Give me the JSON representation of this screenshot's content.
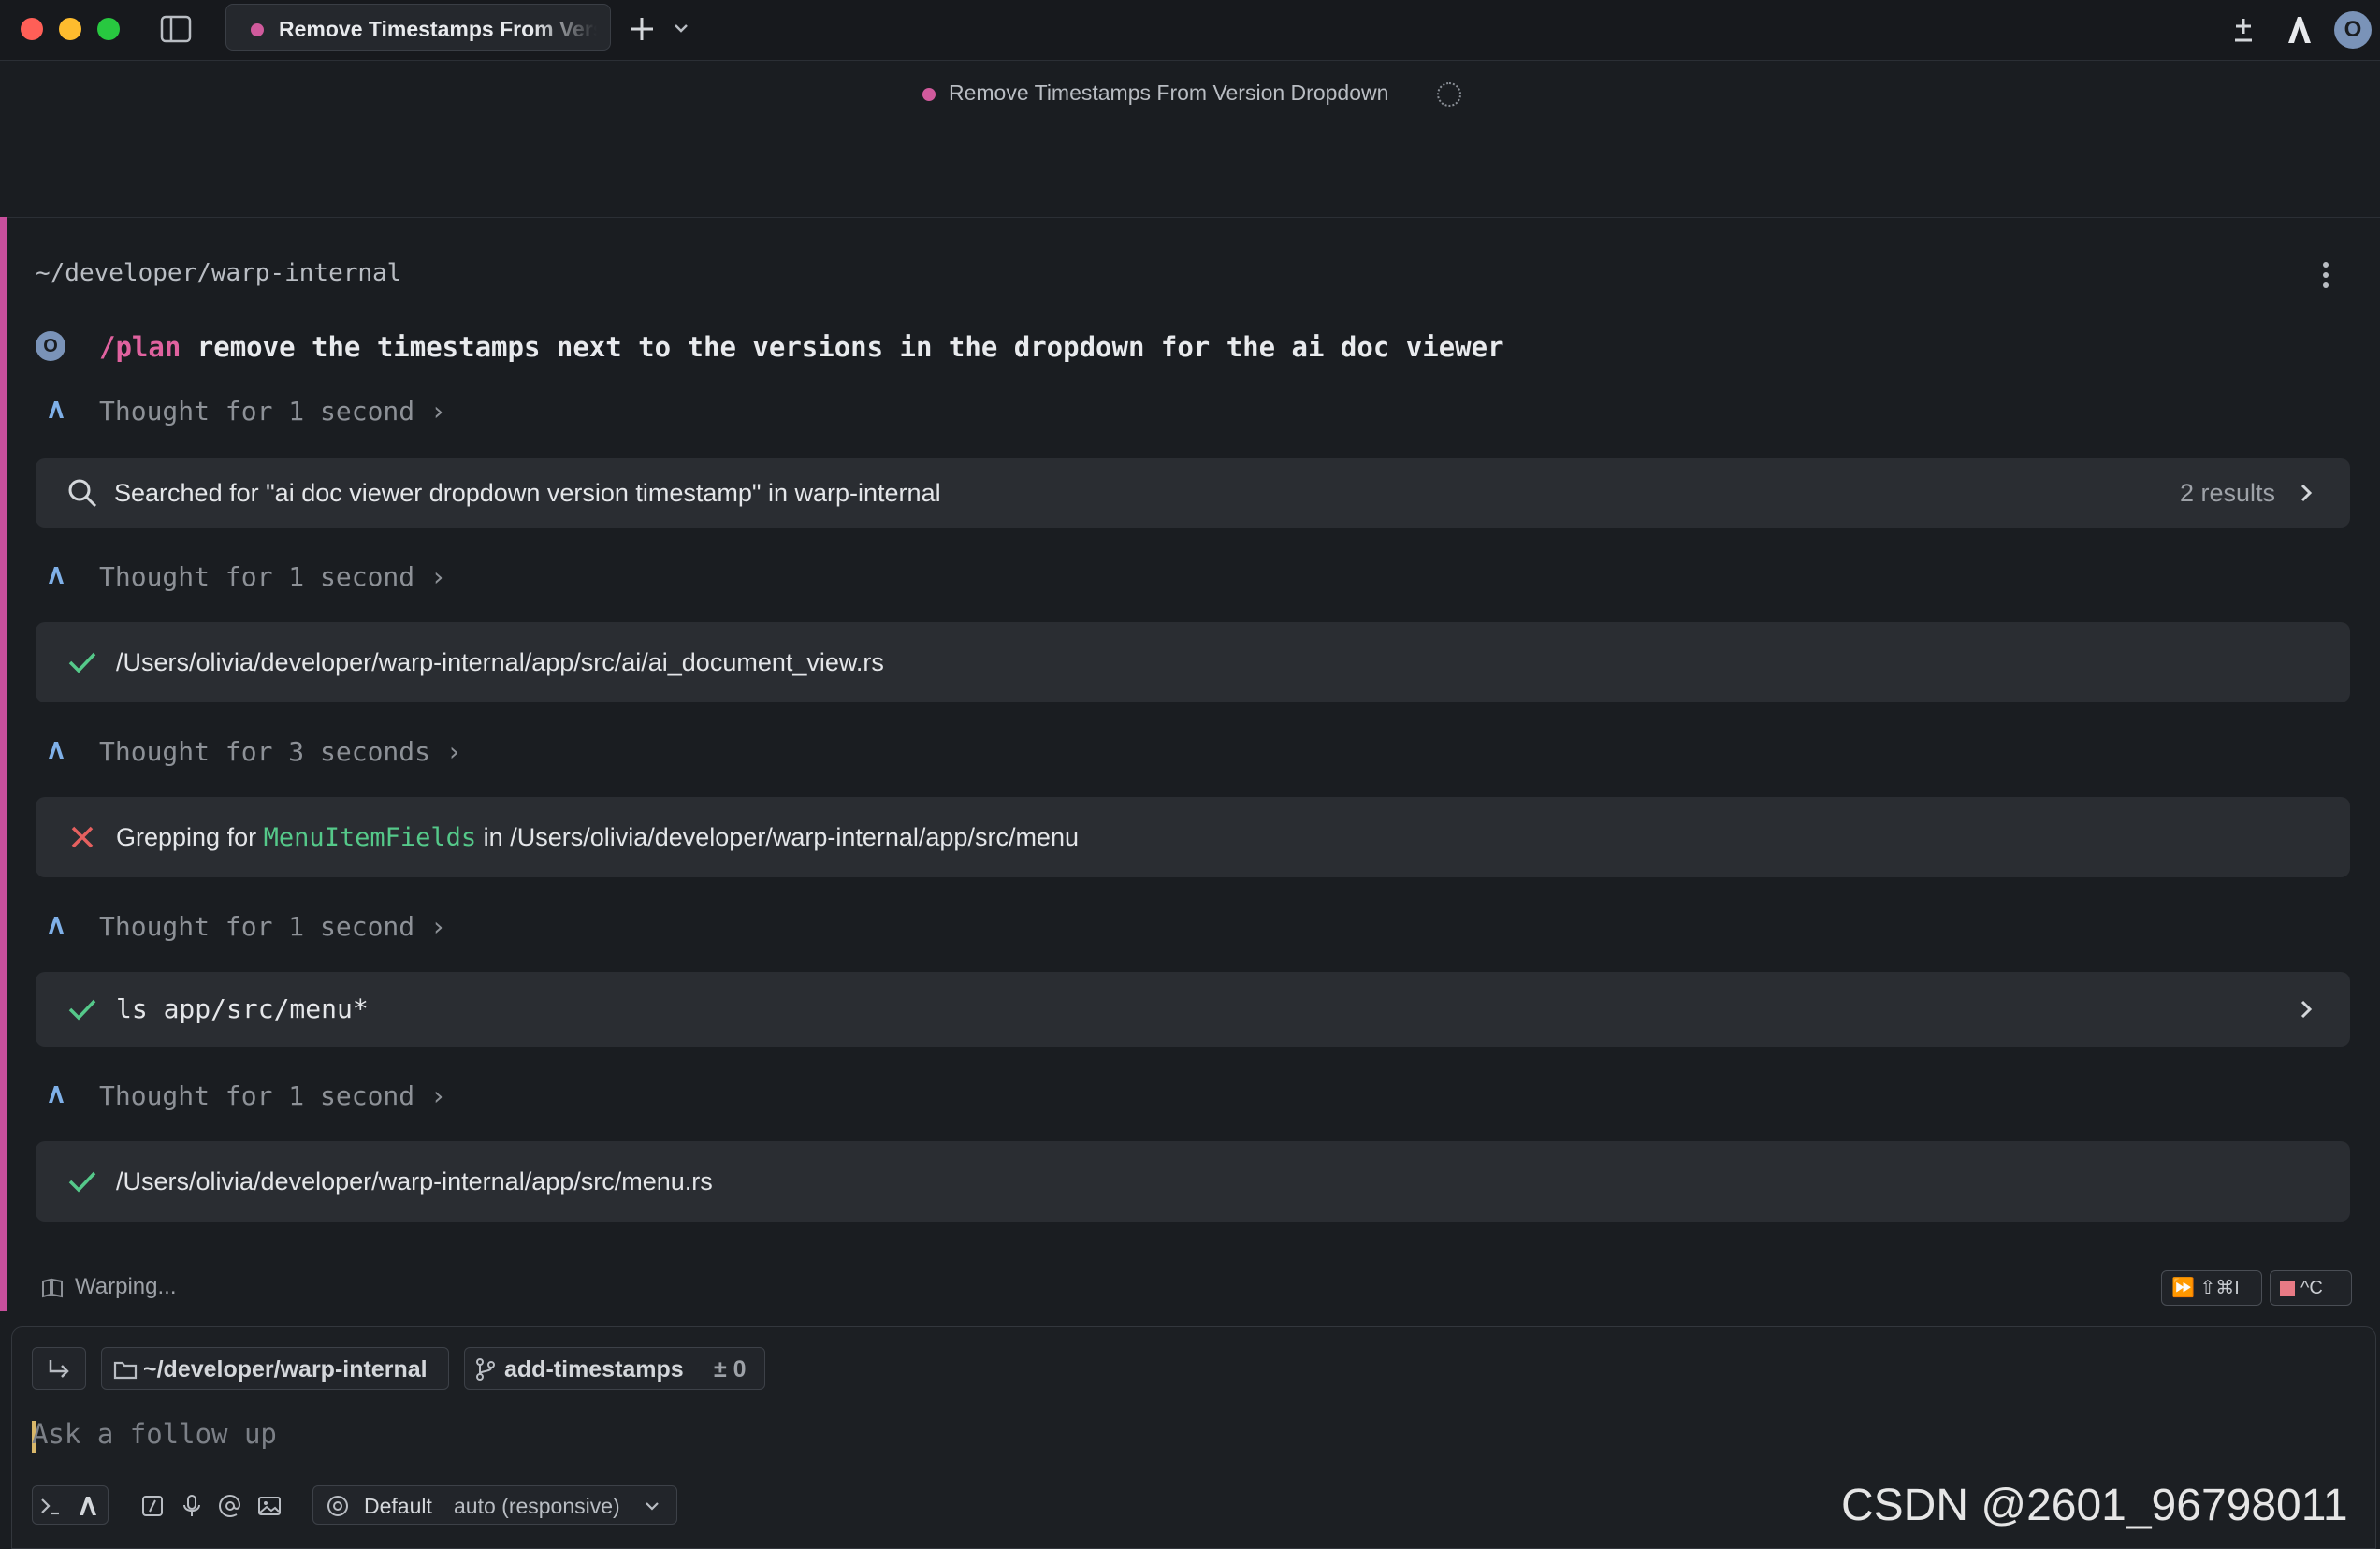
{
  "tab": {
    "title": "Remove Timestamps From Version Dropdown"
  },
  "titlebar": {
    "avatar_initial": "O",
    "icons": [
      "sidebar-toggle-icon",
      "plus-icon",
      "chevron-down-icon",
      "plus-minus-icon",
      "warp-logo-icon"
    ]
  },
  "session": {
    "title": "Remove Timestamps From Version Dropdown"
  },
  "conversation": {
    "cwd": "~/developer/warp-internal",
    "user": {
      "avatar_initial": "O",
      "command": "/plan",
      "message": " remove the timestamps next to the versions in the dropdown for the ai doc viewer"
    },
    "thoughts": [
      "Thought for 1 second",
      "Thought for 1 second",
      "Thought for 3 seconds",
      "Thought for 1 second",
      "Thought for 1 second"
    ],
    "search": {
      "text": "Searched for \"ai doc viewer dropdown version timestamp\" in warp-internal",
      "results": "2 results"
    },
    "file_read_1": "/Users/olivia/developer/warp-internal/app/src/ai/ai_document_view.rs",
    "grep": {
      "prefix": "Grepping for ",
      "pattern": "MenuItemFields",
      "middle": " in ",
      "path": "/Users/olivia/developer/warp-internal/app/src/menu"
    },
    "command": "ls app/src/menu*",
    "file_read_2": "/Users/olivia/developer/warp-internal/app/src/menu.rs"
  },
  "status": {
    "text": "Warping...",
    "fast_forward_keys": "⇧⌘I",
    "stop_keys": "^C"
  },
  "input": {
    "directory": "~/developer/warp-internal",
    "branch": "add-timestamps",
    "diff": "± 0",
    "placeholder": "Ask a follow up",
    "profile": "Default",
    "model": "auto (responsive)"
  },
  "colors": {
    "accent": "#c84f9c",
    "success": "#55c98a",
    "error": "#e5605f",
    "highlight": "#55c98a"
  },
  "watermark": "CSDN @2601_96798011"
}
